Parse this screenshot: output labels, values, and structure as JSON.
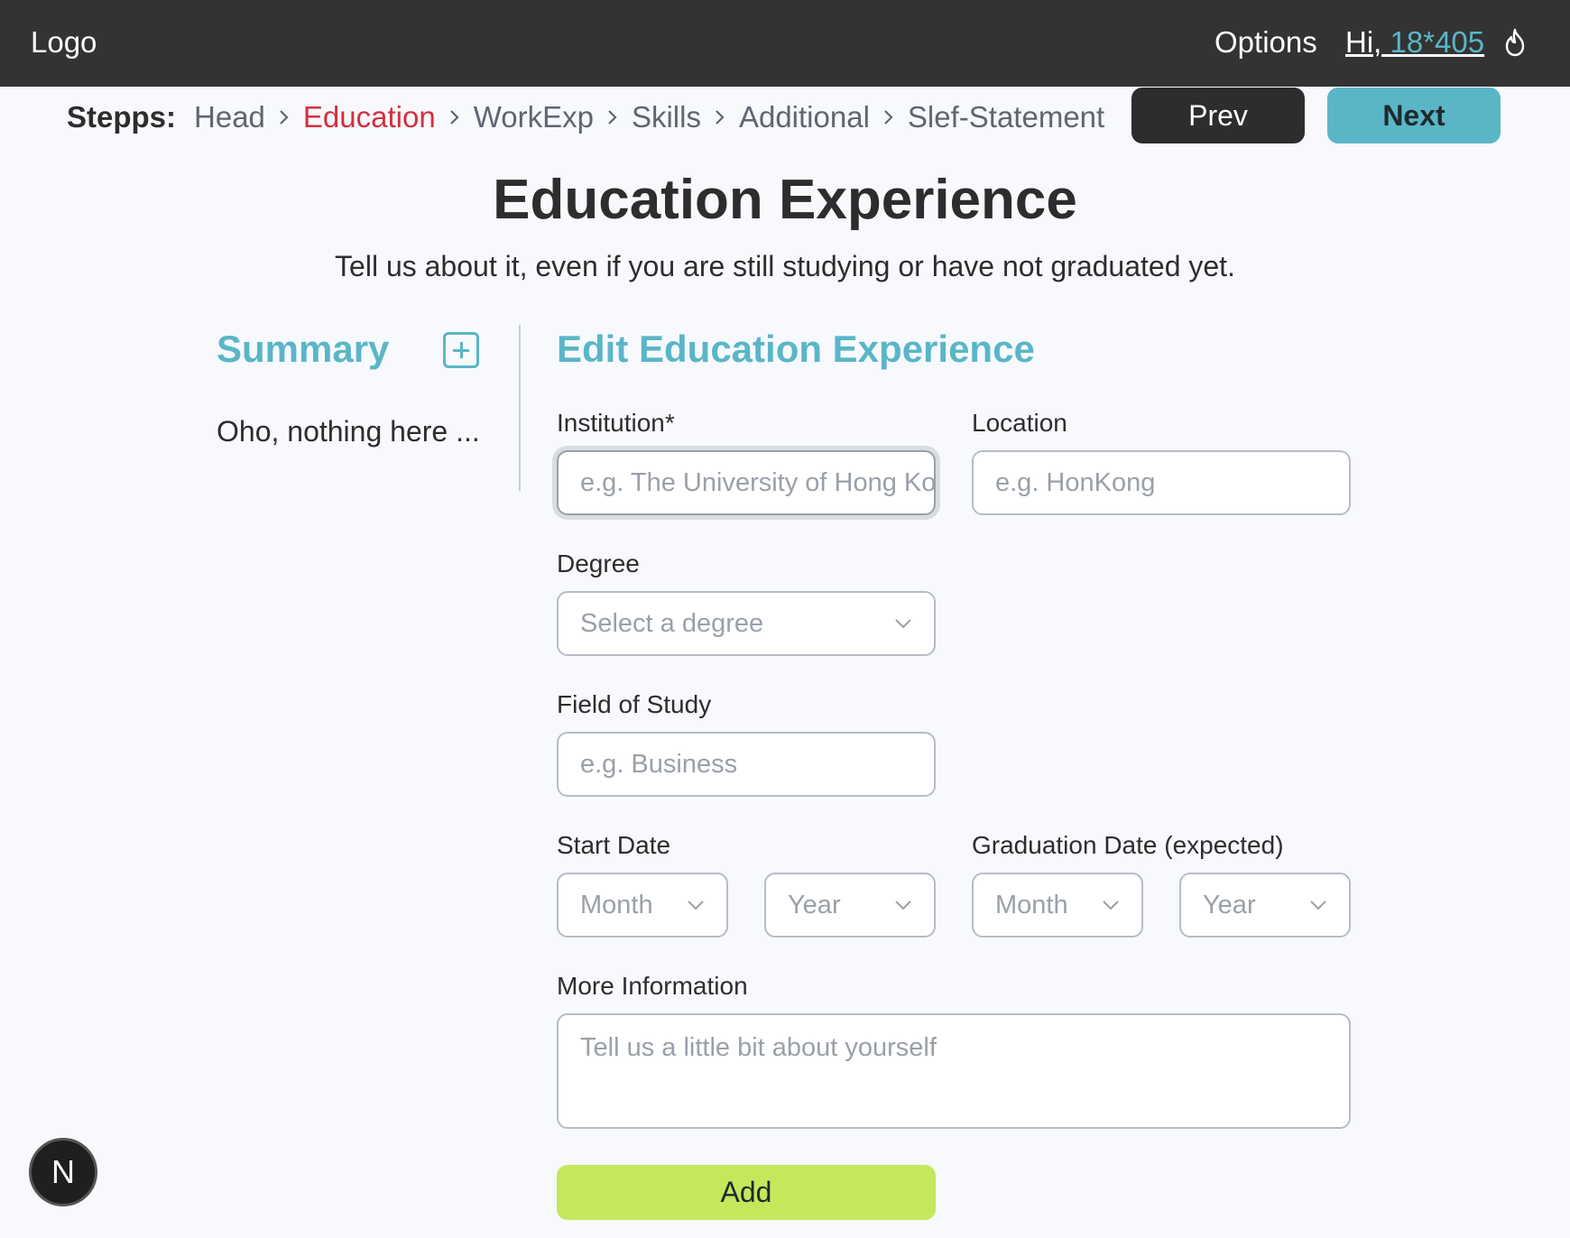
{
  "header": {
    "logo": "Logo",
    "options": "Options",
    "greeting_prefix": "Hi,",
    "username": " 18*405",
    "theme_icon": "flame-icon"
  },
  "steps": {
    "label": "Stepps:",
    "items": [
      "Head",
      "Education",
      "WorkExp",
      "Skills",
      "Additional",
      "Slef-Statement"
    ],
    "active": "Education",
    "prev_label": "Prev",
    "next_label": "Next"
  },
  "page": {
    "title": "Education Experience",
    "subtitle": "Tell us about it, even if you are still studying or have not graduated yet."
  },
  "summary": {
    "title": "Summary",
    "empty_text": "Oho, nothing here ..."
  },
  "form": {
    "title": "Edit Education Experience",
    "institution": {
      "label": "Institution*",
      "placeholder": "e.g. The University of Hong Kong"
    },
    "location": {
      "label": "Location",
      "placeholder": "e.g. HonKong"
    },
    "degree": {
      "label": "Degree",
      "placeholder": "Select a degree"
    },
    "field_of_study": {
      "label": "Field of Study",
      "placeholder": "e.g. Business"
    },
    "start_date": {
      "label": "Start Date",
      "month_placeholder": "Month",
      "year_placeholder": "Year"
    },
    "graduation_date": {
      "label": "Graduation Date (expected)",
      "month_placeholder": "Month",
      "year_placeholder": "Year"
    },
    "more_info": {
      "label": "More Information",
      "placeholder": "Tell us a little bit about yourself"
    },
    "add_label": "Add"
  },
  "badge": {
    "letter": "N"
  },
  "colors": {
    "topbar": "#333333",
    "accent": "#5ab6c7",
    "active_step": "#d2303f",
    "add_button": "#c3e85c",
    "prev_button": "#2d2d2d"
  }
}
